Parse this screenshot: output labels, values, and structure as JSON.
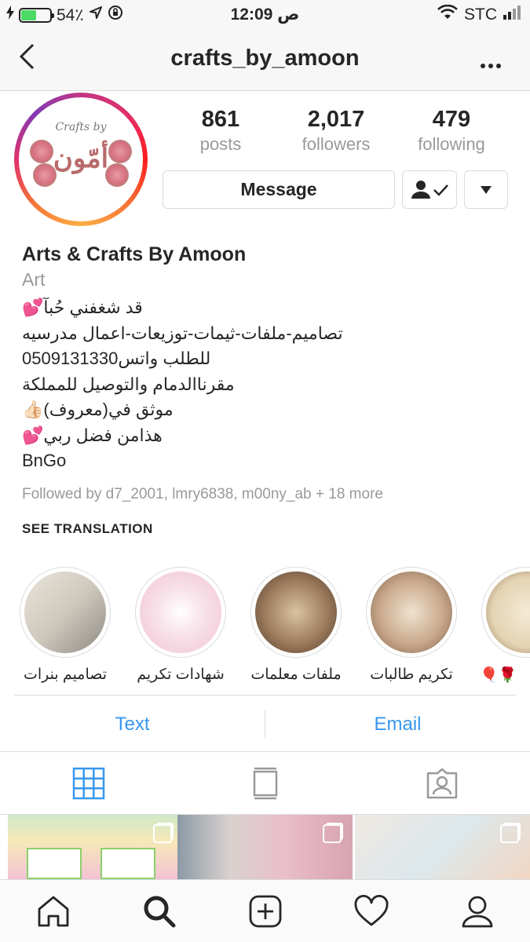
{
  "status_bar": {
    "battery": "54٪",
    "battery_level": 0.54,
    "time": "12:09 ص",
    "carrier": "STC"
  },
  "nav": {
    "username": "crafts_by_amoon",
    "more_label": "•••"
  },
  "avatar": {
    "top_text": "Crafts by",
    "name_text": "أمّون"
  },
  "stats": [
    {
      "value": "861",
      "label": "posts"
    },
    {
      "value": "2,017",
      "label": "followers"
    },
    {
      "value": "479",
      "label": "following"
    }
  ],
  "actions": {
    "message_label": "Message"
  },
  "bio": {
    "name": "Arts & Crafts By Amoon",
    "category": "Art",
    "lines": [
      "قد شغفني حُبآ💕",
      "تصاميم-ملفات-ثيمات-توزيعات-اعمال مدرسيه",
      "للطلب واتس0509131330",
      "مقرناالدمام والتوصيل للمملكة",
      "موثق في(معروف)👍🏻",
      "هذامن فضل ربي💕",
      "BnGo"
    ],
    "followed_by": "Followed by d7_2001, lmry6838, m00ny_ab + 18 more",
    "see_translation": "SEE TRANSLATION"
  },
  "highlights": [
    {
      "label": "تصاميم بنرات",
      "color": "#cfc9bd"
    },
    {
      "label": "شهادات تكريم",
      "color": "#f2c3d2"
    },
    {
      "label": "ملفات معلمات",
      "color": "#9c7a5c"
    },
    {
      "label": "تكريم طالبات",
      "color": "#c9a98c"
    },
    {
      "label": "🌹🎈",
      "color": "#e4d3b3"
    }
  ],
  "contact": {
    "text_label": "Text",
    "email_label": "Email"
  },
  "colors": {
    "link_blue": "#3897f0",
    "active_tab": "#3897f0"
  }
}
